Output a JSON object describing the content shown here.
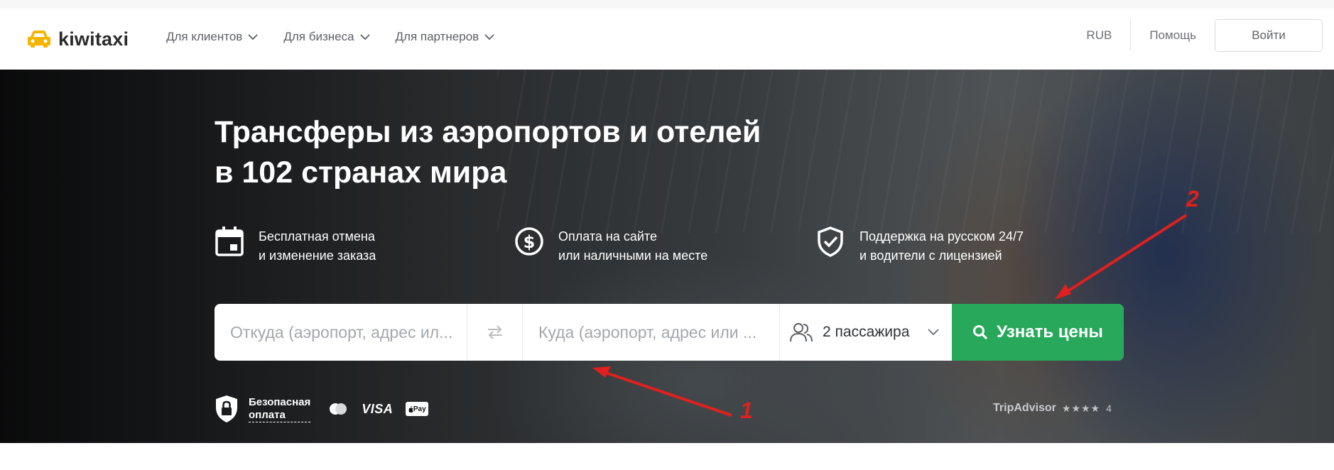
{
  "header": {
    "logo_text": "kiwitaxi",
    "nav": [
      {
        "label": "Для клиентов"
      },
      {
        "label": "Для бизнеса"
      },
      {
        "label": "Для партнеров"
      }
    ],
    "currency": "RUB",
    "help": "Помощь",
    "login": "Войти"
  },
  "hero": {
    "title_line1": "Трансферы из аэропортов и отелей",
    "title_line2": "в 102 странах мира",
    "features": [
      {
        "icon": "calendar-icon",
        "line1": "Бесплатная отмена",
        "line2": "и изменение заказа"
      },
      {
        "icon": "dollar-coin-icon",
        "line1": "Оплата на сайте",
        "line2": "или наличными на месте"
      },
      {
        "icon": "shield-check-icon",
        "line1": "Поддержка на русском 24/7",
        "line2": "и водители с лицензией"
      }
    ]
  },
  "search": {
    "from_placeholder": "Откуда (аэропорт, адрес ил...",
    "to_placeholder": "Куда (аэропорт, адрес или ...",
    "passengers": "2 пассажира",
    "cta": "Узнать цены"
  },
  "footer_strip": {
    "secure_line1": "Безопасная",
    "secure_line2": "оплата",
    "visa": "VISA",
    "apple_pay": "Pay",
    "tripadvisor": "TripAdvisor",
    "stars": "★★★★",
    "rating": "4"
  },
  "annotations": {
    "arrow1_label": "1",
    "arrow2_label": "2",
    "arrow_color": "#e0201e"
  },
  "colors": {
    "accent": "#27a85a",
    "logo_yellow": "#f5b400"
  }
}
